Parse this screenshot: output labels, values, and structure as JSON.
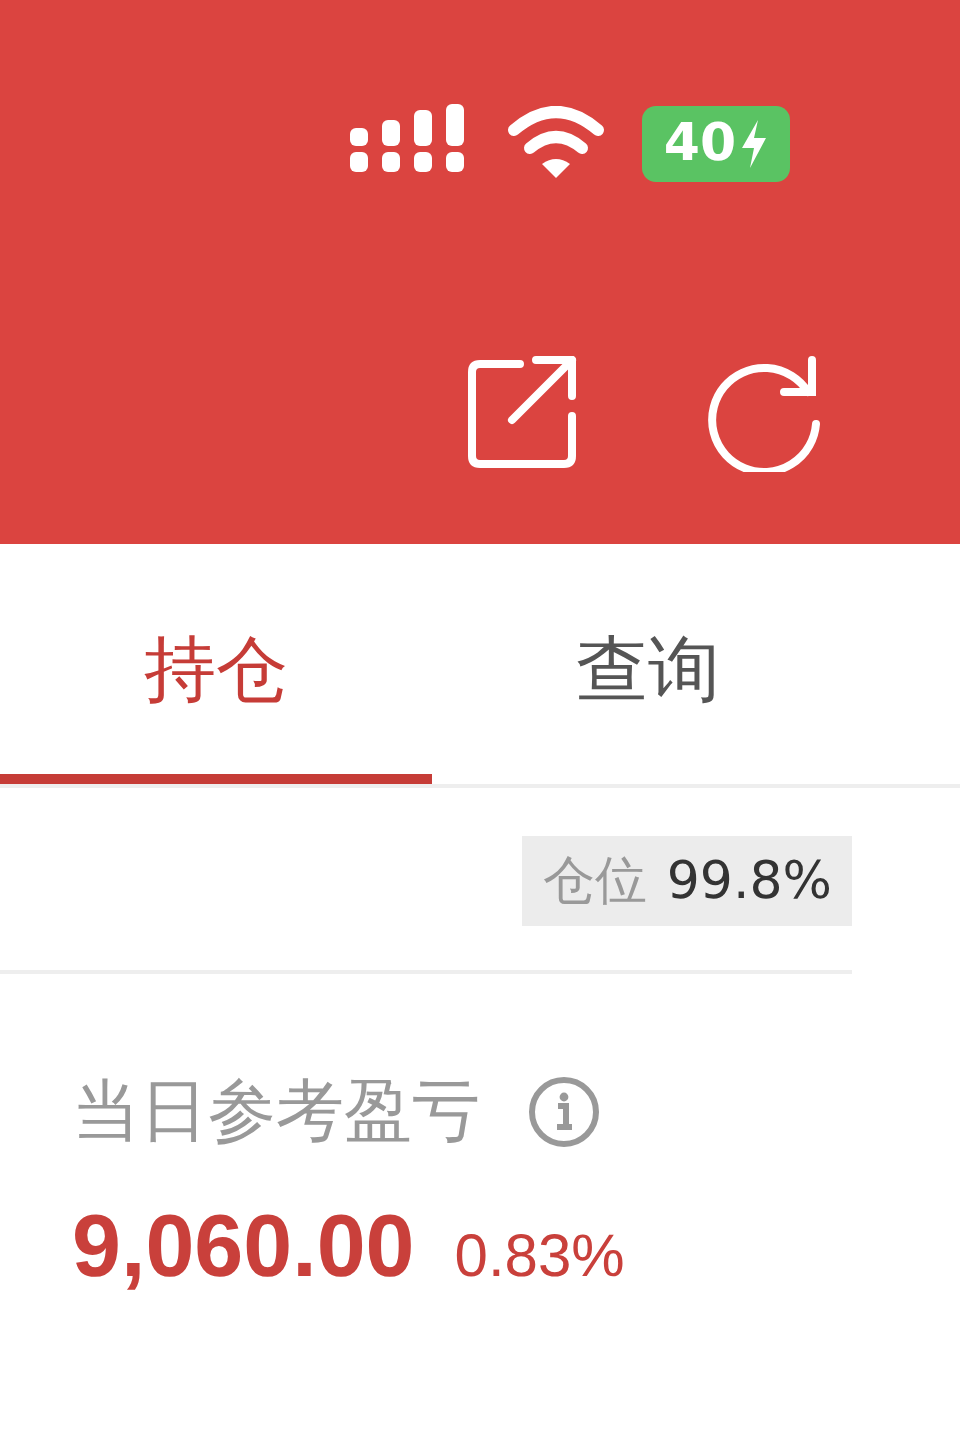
{
  "status_bar": {
    "battery": "40",
    "charging": true
  },
  "tabs": [
    {
      "label": "持仓",
      "selected": true
    },
    {
      "label": "查询",
      "selected": false
    }
  ],
  "position": {
    "label": "仓位",
    "value": "99.8%"
  },
  "pnl": {
    "label": "当日参考盈亏",
    "value": "9,060.00",
    "percent": "0.83%"
  }
}
